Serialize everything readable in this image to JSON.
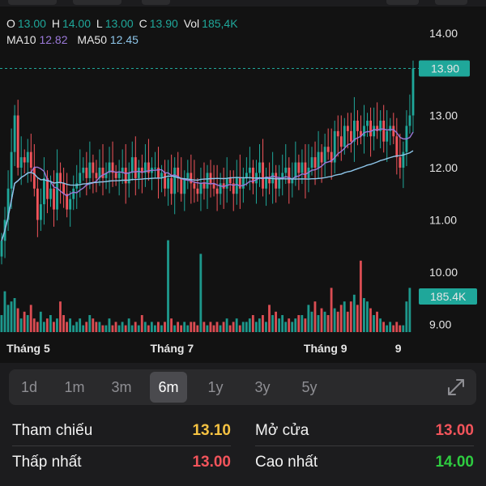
{
  "ohlc": {
    "o_label": "O",
    "o_value": "13.00",
    "h_label": "H",
    "h_value": "14.00",
    "l_label": "L",
    "l_value": "13.00",
    "c_label": "C",
    "c_value": "13.90",
    "vol_label": "Vol",
    "vol_value": "185,4K"
  },
  "ma": {
    "ma10_label": "MA10",
    "ma10_value": "12.82",
    "ma50_label": "MA50",
    "ma50_value": "12.45"
  },
  "price_badge": "13.90",
  "volume_badge": "185.4K",
  "colors": {
    "up": "#1fa79a",
    "down": "#f2545b",
    "ma10": "#9b79d9",
    "ma50": "#8ec6ea",
    "ref": "#f5c242",
    "high": "#2ecc40"
  },
  "chart_data": {
    "type": "candlestick",
    "ylim": [
      9.0,
      14.0
    ],
    "y_ticks": [
      "13.00",
      "12.00",
      "11.00",
      "10.00",
      "9.00"
    ],
    "y_top_tick": "14.00",
    "x_ticks": [
      "Tháng 5",
      "Tháng 7",
      "Tháng 9",
      "9"
    ],
    "x_tick_index": [
      2,
      46,
      93,
      121
    ],
    "current_price": 13.9,
    "closes": [
      10.6,
      11.0,
      11.6,
      12.3,
      13.0,
      12.0,
      12.2,
      12.1,
      12.3,
      12.0,
      11.6,
      11.0,
      11.3,
      11.8,
      11.4,
      11.6,
      11.2,
      11.9,
      11.7,
      11.5,
      11.2,
      11.4,
      11.6,
      11.7,
      11.9,
      12.0,
      11.8,
      12.1,
      11.9,
      11.8,
      12.0,
      11.8,
      11.9,
      12.1,
      11.9,
      11.8,
      11.9,
      12.0,
      11.7,
      11.9,
      12.2,
      11.8,
      12.0,
      11.9,
      12.1,
      11.9,
      12.0,
      12.0,
      11.8,
      11.9,
      11.6,
      11.8,
      11.5,
      12.0,
      11.8,
      11.5,
      11.8,
      11.9,
      11.7,
      11.6,
      11.5,
      11.7,
      11.6,
      11.9,
      11.7,
      11.6,
      11.5,
      11.7,
      11.6,
      11.8,
      11.7,
      11.5,
      11.8,
      11.6,
      11.8,
      11.9,
      12.0,
      11.7,
      11.9,
      12.1,
      11.6,
      11.8,
      11.7,
      11.9,
      11.6,
      11.8,
      11.9,
      12.0,
      11.7,
      11.8,
      12.1,
      11.9,
      12.1,
      11.8,
      12.0,
      12.2,
      12.0,
      12.3,
      12.1,
      12.4,
      12.3,
      12.1,
      12.7,
      12.6,
      12.4,
      12.8,
      12.7,
      12.5,
      12.9,
      12.7,
      12.6,
      12.8,
      12.9,
      12.6,
      12.8,
      12.7,
      12.9,
      12.5,
      12.7,
      12.8,
      12.6,
      12.2,
      12.0,
      12.3,
      12.8,
      13.0,
      13.9
    ],
    "volumes": [
      0.5,
      1.2,
      0.8,
      0.9,
      1.0,
      0.7,
      0.4,
      0.6,
      0.5,
      0.8,
      0.4,
      0.3,
      0.6,
      0.3,
      0.4,
      0.5,
      0.3,
      0.4,
      0.9,
      0.5,
      0.3,
      0.4,
      0.2,
      0.3,
      0.4,
      0.2,
      0.3,
      0.5,
      0.4,
      0.3,
      0.3,
      0.2,
      0.2,
      0.4,
      0.2,
      0.3,
      0.2,
      0.3,
      0.2,
      0.4,
      0.2,
      0.3,
      0.2,
      0.5,
      0.3,
      0.2,
      0.3,
      0.2,
      0.3,
      0.2,
      0.3,
      2.7,
      0.4,
      0.2,
      0.3,
      0.2,
      0.3,
      0.2,
      0.3,
      0.3,
      0.2,
      2.3,
      0.3,
      0.2,
      0.3,
      0.2,
      0.3,
      0.2,
      0.3,
      0.4,
      0.2,
      0.3,
      0.4,
      0.2,
      0.3,
      0.3,
      0.4,
      0.5,
      0.3,
      0.4,
      0.5,
      0.3,
      0.8,
      0.5,
      0.6,
      0.4,
      0.5,
      0.3,
      0.4,
      0.3,
      0.4,
      0.5,
      0.5,
      0.4,
      0.8,
      0.6,
      0.9,
      0.5,
      0.7,
      0.6,
      0.5,
      1.3,
      0.7,
      0.6,
      0.8,
      0.9,
      0.6,
      0.9,
      1.1,
      0.8,
      2.1,
      1.0,
      0.9,
      0.7,
      0.5,
      0.6,
      0.4,
      0.3,
      0.2,
      0.3,
      0.2,
      0.3,
      0.2,
      0.2,
      0.9,
      1.3
    ]
  },
  "ranges": [
    {
      "label": "1d"
    },
    {
      "label": "1m"
    },
    {
      "label": "3m"
    },
    {
      "label": "6m"
    },
    {
      "label": "1y"
    },
    {
      "label": "3y"
    },
    {
      "label": "5y"
    }
  ],
  "active_range": "6m",
  "stats": {
    "ref_label": "Tham chiếu",
    "ref_value": "13.10",
    "open_label": "Mở cửa",
    "open_value": "13.00",
    "low_label": "Thấp nhất",
    "low_value": "13.00",
    "high_label": "Cao nhất",
    "high_value": "14.00"
  }
}
